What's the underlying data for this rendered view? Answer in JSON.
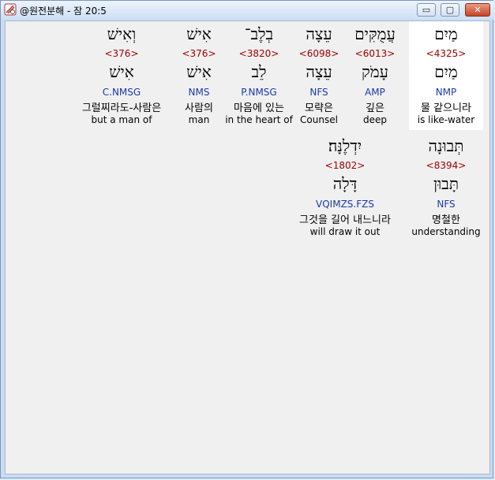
{
  "window": {
    "title": "@원전분해 - 잠 20:5",
    "controls": {
      "minimize": "▭",
      "maximize": "▢",
      "close": "✕"
    }
  },
  "rows": [
    [
      {
        "hebrew": "מַיִם",
        "strongs": "<4325>",
        "root": "מַיִם",
        "morph": "NMP",
        "korean": "물 같으니라",
        "english": "is like-water"
      },
      {
        "hebrew": "עֲמֻקִּים",
        "strongs": "<6013>",
        "root": "עָמֹק",
        "morph": "AMP",
        "korean": "깊은",
        "english": "deep"
      },
      {
        "hebrew": "עֵצָה",
        "strongs": "<6098>",
        "root": "עֵצָה",
        "morph": "NFS",
        "korean": "모략은",
        "english": "Counsel"
      },
      {
        "hebrew": "בְלֶב־",
        "strongs": "<3820>",
        "root": "לֵב",
        "morph": "P.NMSG",
        "korean": "마음에 있는",
        "english": "in the heart of"
      },
      {
        "hebrew": "אִישׁ",
        "strongs": "<376>",
        "root": "אִישׁ",
        "morph": "NMS",
        "korean": "사람의",
        "english": "man"
      },
      {
        "hebrew": "וְאִישׁ",
        "strongs": "<376>",
        "root": "אִישׁ",
        "morph": "C.NMSG",
        "korean": "그럴찌라도-사람은",
        "english": "but a man of"
      }
    ],
    [
      {
        "hebrew": "תְּבוּנָה",
        "strongs": "<8394>",
        "root": "תָּבוּן",
        "morph": "NFS",
        "korean": "명철한",
        "english": "understanding"
      },
      {
        "hebrew": "יִדְלֶנָּה׃",
        "strongs": "<1802>",
        "root": "דָּלָה",
        "morph": "VQIMZS.FZS",
        "korean": "그것을 길어 내느니라",
        "english": "will draw it out"
      }
    ]
  ]
}
